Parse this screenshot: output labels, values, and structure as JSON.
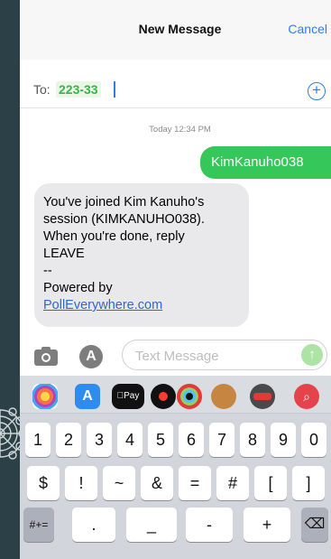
{
  "header": {
    "title": "New Message",
    "cancel_label": "Cancel"
  },
  "to_field": {
    "label": "To:",
    "value": "223-33"
  },
  "conversation": {
    "timestamp": "Today 12:34 PM",
    "sent_message": "KimKanuho038",
    "received_lines": [
      "You've joined Kim Kanuho's",
      "session (KIMKANUHO038).",
      "When you're done, reply",
      "LEAVE",
      "--",
      "Powered by",
      "PollEverywhere.com"
    ]
  },
  "composer": {
    "placeholder": "Text Message"
  },
  "app_strip": {
    "apple_pay_label": "Pay"
  },
  "keyboard": {
    "row1": [
      "1",
      "2",
      "3",
      "4",
      "5",
      "6",
      "7",
      "8",
      "9",
      "0"
    ],
    "row2": [
      "$",
      "!",
      "~",
      "&",
      "=",
      "#",
      "[",
      "]"
    ],
    "row3": [
      "#+=",
      ".",
      "_",
      "-",
      "+",
      "⌫"
    ]
  },
  "colors": {
    "accent": "#2f7ee6",
    "sent_bubble": "#35c759",
    "received_bubble": "#e9e9eb",
    "background": "#2b4147"
  }
}
